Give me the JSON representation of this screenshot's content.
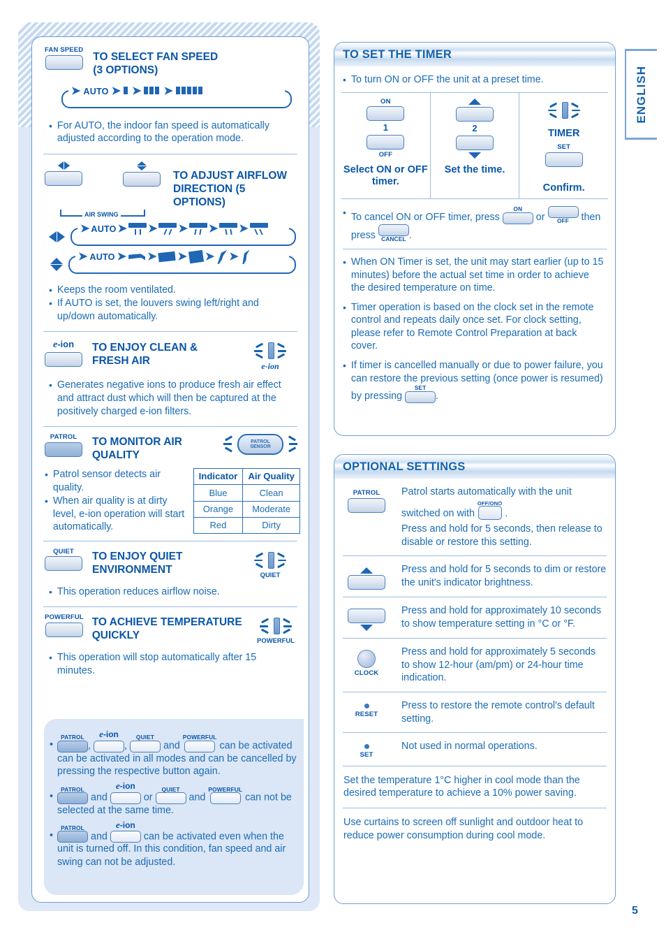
{
  "page": {
    "number": "5",
    "language_tab": "ENGLISH"
  },
  "left": {
    "fan_speed": {
      "button_label": "FAN SPEED",
      "title_line1": "TO SELECT FAN SPEED",
      "title_line2": "(3 OPTIONS)",
      "flow_auto": "AUTO",
      "note": "For AUTO, the indoor fan speed is automatically adjusted according to the operation mode."
    },
    "airflow": {
      "air_swing_label": "AIR SWING",
      "title_line1": "TO ADJUST AIRFLOW",
      "title_line2": "DIRECTION (5 OPTIONS)",
      "flow_auto": "AUTO",
      "notes": [
        "Keeps the room ventilated.",
        "If AUTO is set, the louvers swing left/right and up/down automatically."
      ]
    },
    "eion": {
      "button_label": "e-ion",
      "title_line1": "TO ENJOY CLEAN &",
      "title_line2": "FRESH AIR",
      "indicator_caption": "e-ion",
      "note": "Generates negative ions to produce fresh air effect and attract dust which will then be captured at the positively charged e-ion filters."
    },
    "patrol": {
      "button_label": "PATROL",
      "title_line1": "TO MONITOR AIR",
      "title_line2": "QUALITY",
      "sensor_label_line1": "PATROL",
      "sensor_label_line2": "SENSOR",
      "notes": [
        "Patrol sensor detects air quality.",
        "When air quality is at dirty level, e-ion operation will start automatically."
      ],
      "table": {
        "headers": [
          "Indicator",
          "Air Quality"
        ],
        "rows": [
          [
            "Blue",
            "Clean"
          ],
          [
            "Orange",
            "Moderate"
          ],
          [
            "Red",
            "Dirty"
          ]
        ]
      }
    },
    "quiet": {
      "button_label": "QUIET",
      "title_line1": "TO ENJOY QUIET",
      "title_line2": "ENVIRONMENT",
      "indicator_caption": "QUIET",
      "note": "This operation reduces airflow noise."
    },
    "powerful": {
      "button_label": "POWERFUL",
      "title_line1": "TO ACHIEVE TEMPERATURE",
      "title_line2": "QUICKLY",
      "indicator_caption": "POWERFUL",
      "note": "This operation will stop automatically after 15 minutes."
    },
    "notes": [
      {
        "labels": [
          "PATROL",
          "e-ion",
          "QUIET",
          "POWERFUL"
        ],
        "text_mid": ", , and",
        "text": "can be activated in all modes and can be cancelled by pressing the respective button again.",
        "lead_after_btn3": "and",
        "tail_first_line": "can be activated"
      },
      {
        "labels": [
          "PATROL",
          "e-ion",
          "QUIET",
          "POWERFUL"
        ],
        "conn1": "and",
        "conn2": "or",
        "conn3": "and",
        "tail_first_line": "can not be",
        "text": "selected at the same time."
      },
      {
        "labels": [
          "PATROL",
          "e-ion"
        ],
        "conn1": "and",
        "tail_first_line": "can be activated even when the",
        "text": "unit is turned off. In this condition, fan speed and air swing can not be adjusted."
      }
    ]
  },
  "right": {
    "timer": {
      "heading": "TO SET THE TIMER",
      "intro": "To turn ON or OFF the unit at a preset time.",
      "steps": [
        {
          "top_label": "ON",
          "num": "1",
          "bottom_label": "OFF",
          "caption": "Select ON or OFF timer."
        },
        {
          "num": "2",
          "caption": "Set the time."
        },
        {
          "indicator_caption": "TIMER",
          "button_label": "SET",
          "caption": "Confirm."
        }
      ],
      "cancel": {
        "part1": "To cancel ON or OFF timer, press",
        "btn1_label": "ON",
        "or": "or",
        "btn2_label": "OFF",
        "part2": "then",
        "part3": "press",
        "btn3_label": "CANCEL",
        "period": "."
      },
      "notes": [
        "When ON Timer is set, the unit may start earlier (up to 15 minutes) before the actual set time in order to achieve the desired temperature on time.",
        "Timer operation is based on the clock set in the remote control and repeats daily once set. For clock setting, please refer to Remote Control Preparation at back cover."
      ],
      "restore_note": {
        "part1": "If timer is cancelled manually or due to power failure, you can restore the previous setting (once power is resumed) by pressing",
        "btn_label": "SET",
        "part2": "."
      }
    },
    "optional": {
      "heading": "OPTIONAL SETTINGS",
      "rows": [
        {
          "icon": "patrol-button",
          "button_label": "PATROL",
          "text1_a": "Patrol starts automatically with the unit",
          "text1_b": "switched on with",
          "inline_btn_label": "OFF/ON",
          "text1_c": ".",
          "text2": "Press and hold for 5 seconds, then release to disable or restore this setting."
        },
        {
          "icon": "up-arrow-button",
          "text": "Press and hold for 5 seconds to dim or restore the unit's indicator brightness."
        },
        {
          "icon": "down-arrow-button",
          "text": "Press and hold for approximately 10 seconds to show temperature setting in °C or °F."
        },
        {
          "icon": "clock-button",
          "button_label": "CLOCK",
          "text": "Press and hold for approximately 5 seconds to show 12-hour (am/pm) or 24-hour time indication."
        },
        {
          "icon": "reset-button",
          "button_label": "RESET",
          "text": "Press to restore the remote control's default setting."
        },
        {
          "icon": "set-button",
          "button_label": "SET",
          "text": "Not used in normal operations."
        }
      ],
      "tips": [
        "Set the temperature 1°C higher in cool mode than the desired temperature to achieve a 10% power saving.",
        "Use curtains to screen off sunlight and outdoor heat to reduce power consumption during cool mode."
      ]
    }
  }
}
